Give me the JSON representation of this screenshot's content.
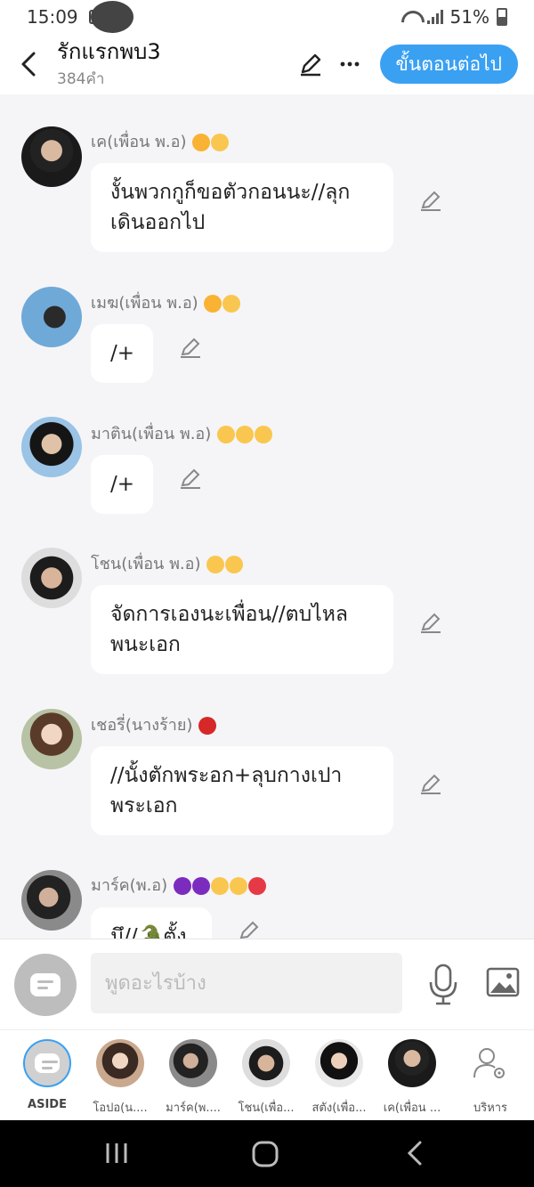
{
  "status_bar": {
    "time": "15:09",
    "battery": "51%"
  },
  "header": {
    "title": "รักแรกพบ3",
    "subtitle": "384คำ",
    "next_label": "ขั้นตอนต่อไป"
  },
  "messages": [
    {
      "name": "เค(เพื่อน พ.อ)",
      "emojis": [
        "#f9b233",
        "#f9c74f"
      ],
      "text_lines": [
        "งั้นพวกกูก็ขอตัวกอนนะ//ลุก",
        "เดินออกไป"
      ]
    },
    {
      "name": "เมฆ(เพื่อน พ.อ)",
      "emojis": [
        "#f9b233",
        "#f9c74f"
      ],
      "text_lines": [
        "/+"
      ]
    },
    {
      "name": "มาติน(เพื่อน พ.อ)",
      "emojis": [
        "#f9c74f",
        "#f9c74f",
        "#f9c74f"
      ],
      "text_lines": [
        "/+"
      ]
    },
    {
      "name": "โชน(เพื่อน พ.อ)",
      "emojis": [
        "#f9c74f",
        "#f9c74f"
      ],
      "text_lines": [
        "จัดการเองนะเพื่อน//ตบไหล",
        "พนะเอก"
      ]
    },
    {
      "name": "เชอรี่(นางร้าย)",
      "emojis": [
        "#d62828"
      ],
      "text_lines": [
        "//นั้งตักพระอก+ลุบกางเปา",
        "พระเอก"
      ]
    },
    {
      "name": "มาร์ค(พ.อ)",
      "emojis": [
        "#7b2cbf",
        "#7b2cbf",
        "#f9c74f",
        "#f9c74f",
        "#e63946"
      ],
      "text_lines": [
        "มึ//🐊ตั้ง"
      ]
    }
  ],
  "input": {
    "placeholder": "พูดอะไรบ้าง"
  },
  "characters": [
    {
      "label": "ASIDE"
    },
    {
      "label": "โอปอ(น...."
    },
    {
      "label": "มาร์ค(พ...."
    },
    {
      "label": "โชน(เพื่อ..."
    },
    {
      "label": "สตัง(เพื่อ..."
    },
    {
      "label": "เค(เพื่อน ..."
    },
    {
      "label": "บริหาร"
    }
  ]
}
